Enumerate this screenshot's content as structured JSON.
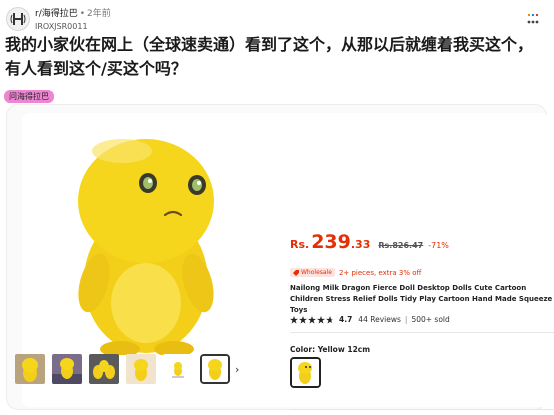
{
  "post": {
    "subreddit": "r/海得拉巴",
    "separator": "•",
    "age": "2年前",
    "username": "IROXJSR0011",
    "title": "我的小家伙在网上（全球速卖通）看到了这个，从那以后就缠着我买这个，有人看到这个/买这个吗？",
    "flair": "问海得拉巴"
  },
  "product": {
    "currency": "Rs.",
    "price_int": "239",
    "price_dec": ".33",
    "original_price": "Rs.826.47",
    "discount": "-71%",
    "wholesale_label": "Wholesale",
    "wholesale_text": "2+ pieces, extra 3% off",
    "title": "Nailong Milk Dragon Fierce Doll Desktop Dolls Cute Cartoon Children Stress Relief Dolls Tidy Play Cartoon Hand Made Squeeze Toys",
    "rating": "4.7",
    "rating_stars": 4.7,
    "reviews": "44 Reviews",
    "sold": "500+ sold",
    "divider": "|",
    "color_label": "Color: Yellow 12cm",
    "thumb_next": "›"
  },
  "colors": {
    "price_red": "#e62e04",
    "flair_pink": "#ee85d3",
    "toy_yellow": "#f6d61c"
  }
}
